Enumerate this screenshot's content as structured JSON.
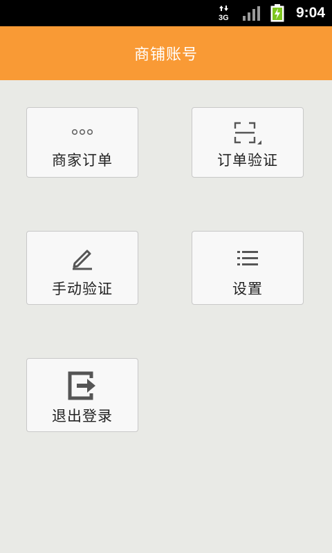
{
  "status_bar": {
    "network": "3G",
    "time": "9:04",
    "icons": [
      "data-transfer-icon",
      "signal-strength-icon",
      "battery-charging-icon"
    ]
  },
  "header": {
    "title": "商铺账号",
    "color": "#f99a35"
  },
  "tiles": [
    {
      "label": "商家订单",
      "icon": "more-dots-icon"
    },
    {
      "label": "订单验证",
      "icon": "scan-frame-icon"
    },
    {
      "label": "手动验证",
      "icon": "pencil-edit-icon"
    },
    {
      "label": "设置",
      "icon": "list-icon"
    },
    {
      "label": "退出登录",
      "icon": "logout-exit-icon"
    }
  ]
}
